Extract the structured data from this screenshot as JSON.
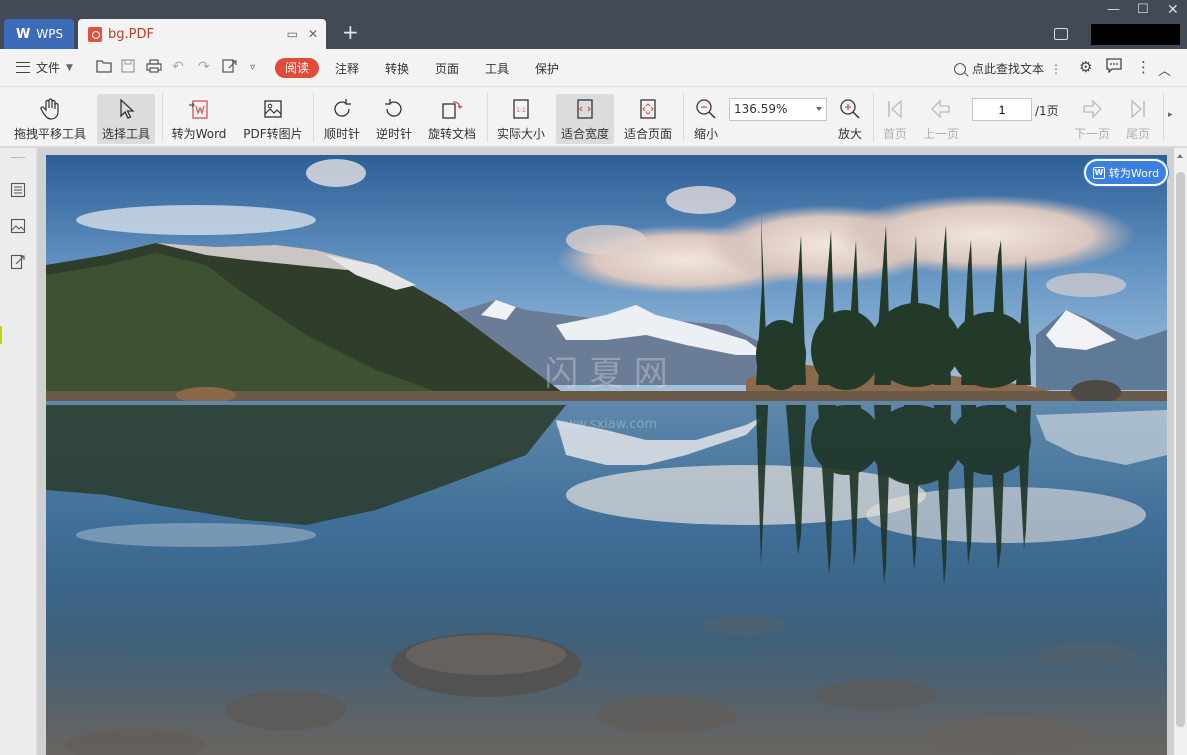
{
  "tabs": {
    "app_label": "WPS",
    "doc_title": "bg.PDF"
  },
  "menu": {
    "file": "文件",
    "read": "阅读",
    "annotate": "注释",
    "convert": "转换",
    "page": "页面",
    "tools": "工具",
    "protect": "保护",
    "find_text": "点此查找文本"
  },
  "toolbar": {
    "pan": "拖拽平移工具",
    "select": "选择工具",
    "to_word": "转为Word",
    "pdf_to_image": "PDF转图片",
    "clockwise": "顺时针",
    "counterclockwise": "逆时针",
    "rotate_doc": "旋转文档",
    "actual_size": "实际大小",
    "fit_width": "适合宽度",
    "fit_page": "适合页面",
    "zoom_out": "缩小",
    "zoom_value": "136.59%",
    "zoom_in": "放大",
    "first_page": "首页",
    "prev_page": "上一页",
    "page_number": "1",
    "page_total": "/1页",
    "next_page": "下一页",
    "last_page": "尾页"
  },
  "floating": {
    "convert_word": "转为Word"
  },
  "document": {
    "watermark_main": "闪 夏 网",
    "watermark_url": "www.sxiaw.com"
  },
  "colors": {
    "titlebar": "#424a58",
    "accent_red": "#e24b3a",
    "accent_blue": "#3b7fe0"
  }
}
